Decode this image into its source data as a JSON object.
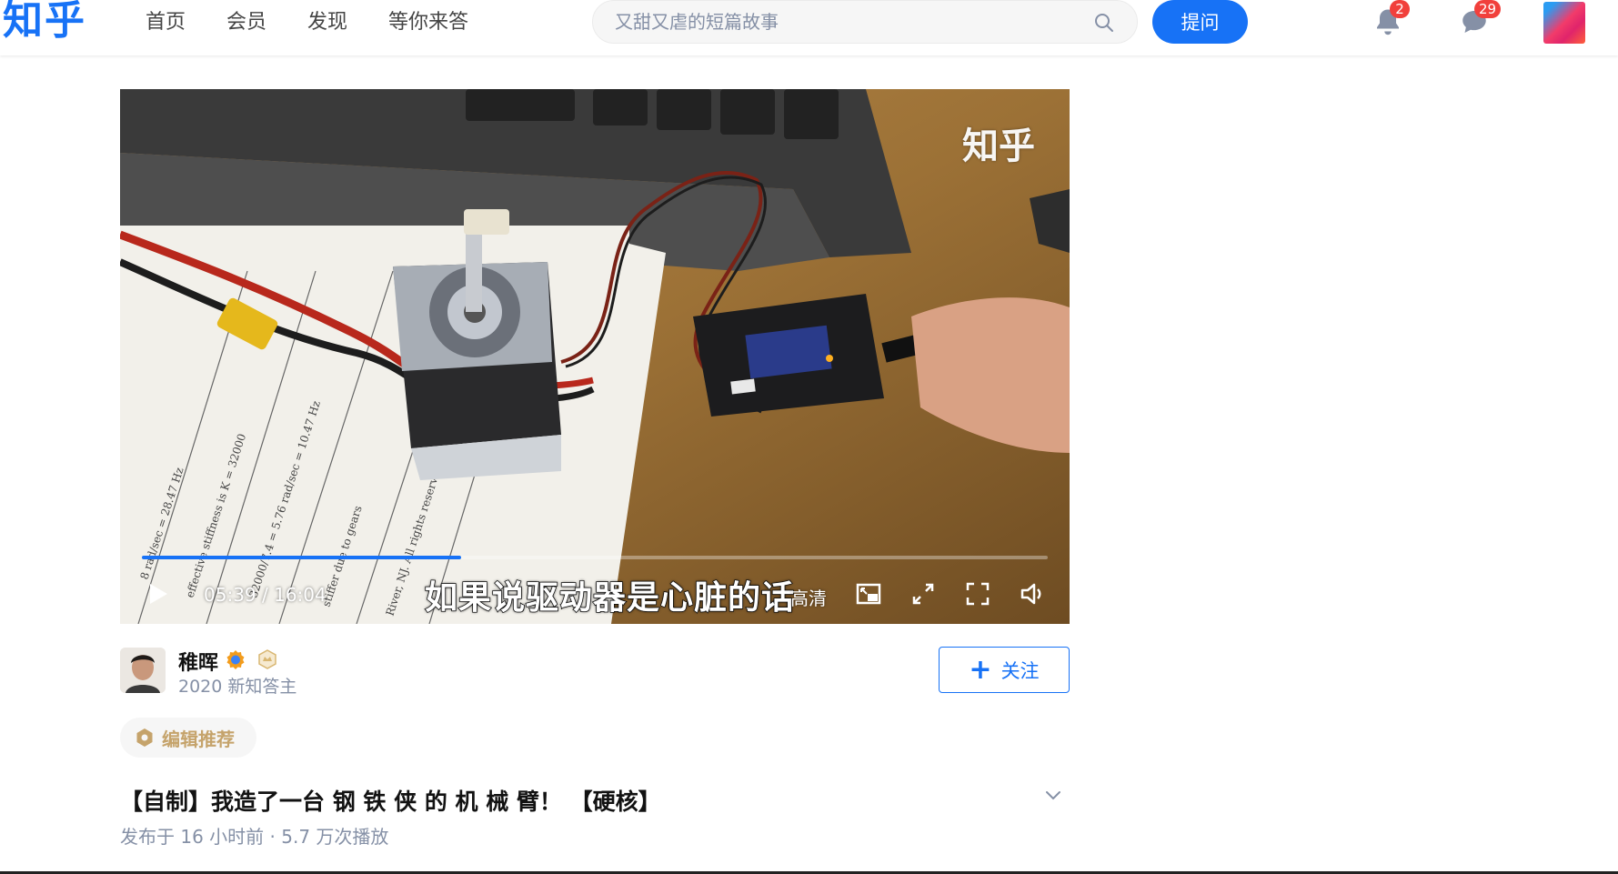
{
  "header": {
    "logo": "知乎",
    "nav": [
      "首页",
      "会员",
      "发现",
      "等你来答"
    ],
    "search_placeholder": "又甜又虐的短篇故事",
    "ask_label": "提问",
    "notification_count": "2",
    "message_count": "29"
  },
  "video": {
    "watermark": "知乎",
    "current_time": "05:39",
    "separator": "/",
    "duration": "16:04",
    "progress": 0.352,
    "subtitle": "如果说驱动器是心脏的话",
    "quality": "高清"
  },
  "author": {
    "name": "稚晖",
    "description": "2020 新知答主",
    "follow_label": "关注"
  },
  "recommendation_tag": "编辑推荐",
  "post": {
    "title": "【自制】我造了一台 钢 铁 侠 的 机 械 臂！ 【硬核】",
    "meta": "发布于 16 小时前 · 5.7 万次播放"
  },
  "colors": {
    "brand": "#1772f6",
    "badge": "#f1403c",
    "muted": "#8590a6",
    "recommend": "#c5a36b"
  }
}
